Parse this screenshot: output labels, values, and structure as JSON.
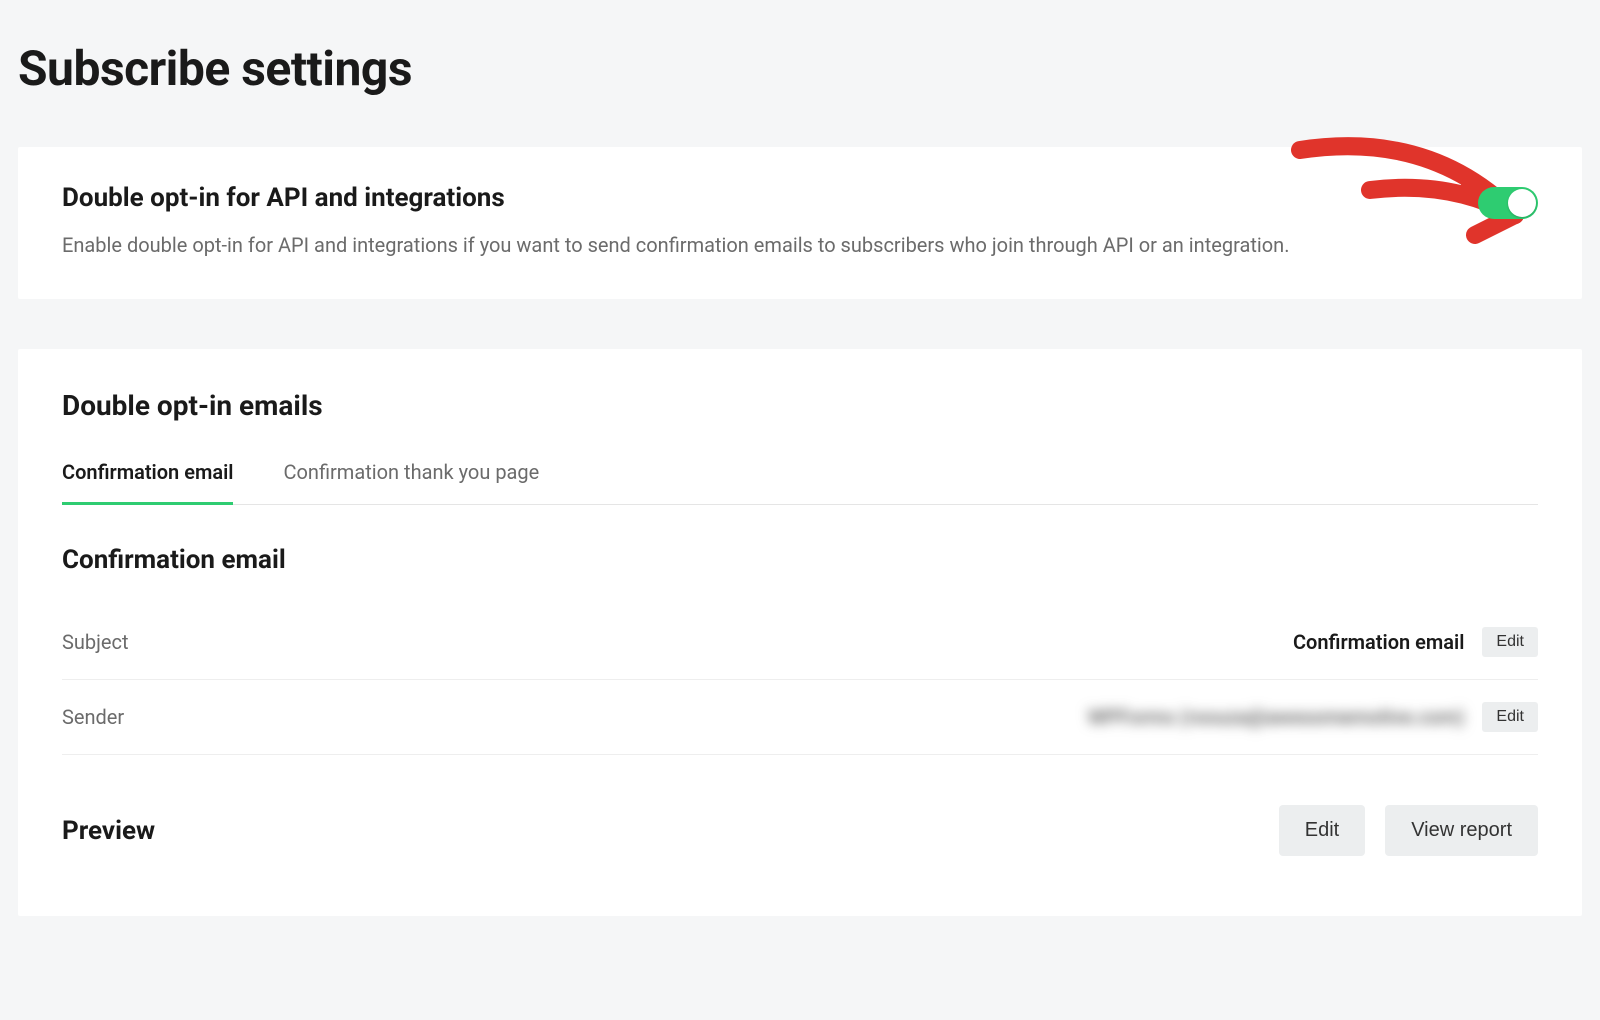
{
  "page": {
    "title": "Subscribe settings"
  },
  "opt_in": {
    "title": "Double opt-in for API and integrations",
    "description": "Enable double opt-in for API and integrations if you want to send confirmation emails to subscribers who join through API or an integration.",
    "enabled": true
  },
  "emails": {
    "section_title": "Double opt-in emails",
    "tabs": [
      {
        "label": "Confirmation email",
        "active": true
      },
      {
        "label": "Confirmation thank you page",
        "active": false
      }
    ],
    "confirmation": {
      "heading": "Confirmation email",
      "rows": {
        "subject": {
          "label": "Subject",
          "value": "Confirmation email",
          "edit_label": "Edit"
        },
        "sender": {
          "label": "Sender",
          "value": "WPForms (rsouza@awesomemotive.com)",
          "edit_label": "Edit",
          "blurred": true
        }
      }
    },
    "preview": {
      "heading": "Preview",
      "edit_label": "Edit",
      "view_report_label": "View report"
    }
  },
  "annotation": {
    "arrow_color": "#e0342b"
  }
}
